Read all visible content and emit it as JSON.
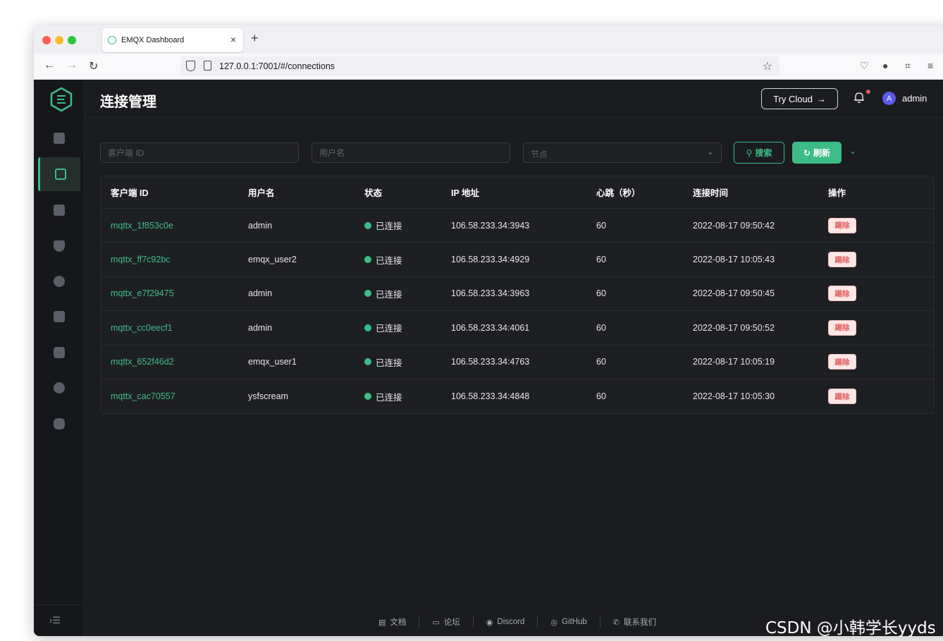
{
  "browser": {
    "tab_title": "EMQX Dashboard",
    "tab_close": "×",
    "new_tab": "+",
    "url": "127.0.0.1:7001/#/connections"
  },
  "header": {
    "title": "连接管理",
    "try_cloud": "Try Cloud",
    "try_cloud_arrow": "→",
    "avatar_letter": "A",
    "user": "admin"
  },
  "filters": {
    "client_id_placeholder": "客户端 ID",
    "username_placeholder": "用户名",
    "node_placeholder": "节点",
    "search_label": "搜索",
    "refresh_label": "刷新"
  },
  "table": {
    "columns": [
      "客户端 ID",
      "用户名",
      "状态",
      "IP 地址",
      "心跳（秒）",
      "连接时间",
      "操作"
    ],
    "rows": [
      {
        "client_id": "mqttx_1f853c0e",
        "username": "admin",
        "status": "已连接",
        "ip": "106.58.233.34:3943",
        "keepalive": "60",
        "connected_at": "2022-08-17 09:50:42",
        "action": "踢除"
      },
      {
        "client_id": "mqttx_ff7c92bc",
        "username": "emqx_user2",
        "status": "已连接",
        "ip": "106.58.233.34:4929",
        "keepalive": "60",
        "connected_at": "2022-08-17 10:05:43",
        "action": "踢除"
      },
      {
        "client_id": "mqttx_e7f29475",
        "username": "admin",
        "status": "已连接",
        "ip": "106.58.233.34:3963",
        "keepalive": "60",
        "connected_at": "2022-08-17 09:50:45",
        "action": "踢除"
      },
      {
        "client_id": "mqttx_cc0eecf1",
        "username": "admin",
        "status": "已连接",
        "ip": "106.58.233.34:4061",
        "keepalive": "60",
        "connected_at": "2022-08-17 09:50:52",
        "action": "踢除"
      },
      {
        "client_id": "mqttx_652f46d2",
        "username": "emqx_user1",
        "status": "已连接",
        "ip": "106.58.233.34:4763",
        "keepalive": "60",
        "connected_at": "2022-08-17 10:05:19",
        "action": "踢除"
      },
      {
        "client_id": "mqttx_cac70557",
        "username": "ysfscream",
        "status": "已连接",
        "ip": "106.58.233.34:4848",
        "keepalive": "60",
        "connected_at": "2022-08-17 10:05:30",
        "action": "踢除"
      }
    ]
  },
  "footer": {
    "docs": "文档",
    "forum": "论坛",
    "discord": "Discord",
    "github": "GitHub",
    "contact": "联系我们"
  },
  "sidebar": {
    "active_index": 1,
    "items": [
      "dashboard-icon",
      "connections-icon",
      "subscriptions-icon",
      "security-icon",
      "integration-icon",
      "settings-icon",
      "plugins-icon",
      "diagnose-icon",
      "system-icon"
    ]
  },
  "colors": {
    "accent": "#3dbc88",
    "danger": "#e05a5a",
    "background": "#1b1c20"
  },
  "watermark": "CSDN @小韩学长yyds"
}
